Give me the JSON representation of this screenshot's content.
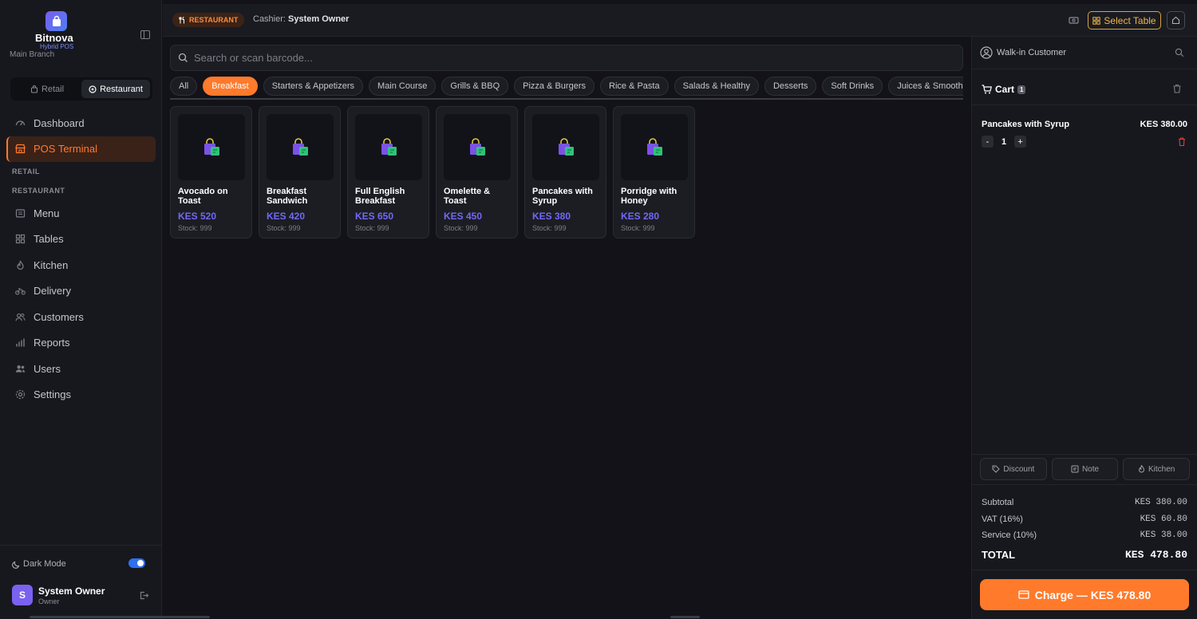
{
  "brand": {
    "name": "Bitnova",
    "subtitle": "Hybrid POS",
    "branch": "Main Branch"
  },
  "mode_switch": {
    "retail": "Retail",
    "restaurant": "Restaurant",
    "active": "restaurant"
  },
  "nav": {
    "dashboard": "Dashboard",
    "pos_terminal": "POS Terminal",
    "section_retail": "RETAIL",
    "section_restaurant": "RESTAURANT",
    "menu": "Menu",
    "tables": "Tables",
    "kitchen": "Kitchen",
    "delivery": "Delivery",
    "customers": "Customers",
    "reports": "Reports",
    "users": "Users",
    "settings": "Settings"
  },
  "footer": {
    "dark_mode": "Dark Mode",
    "dark_mode_on": true,
    "user_initial": "S",
    "user_name": "System Owner",
    "user_role": "Owner"
  },
  "topbar": {
    "mode_badge": "RESTAURANT",
    "cashier_label": "Cashier:",
    "cashier_name": "System Owner",
    "select_table": "Select Table"
  },
  "search": {
    "placeholder": "Search or scan barcode..."
  },
  "categories": [
    "All",
    "Breakfast",
    "Starters & Appetizers",
    "Main Course",
    "Grills & BBQ",
    "Pizza & Burgers",
    "Rice & Pasta",
    "Salads & Healthy",
    "Desserts",
    "Soft Drinks",
    "Juices & Smoothies"
  ],
  "active_category": "Breakfast",
  "products": [
    {
      "name": "Avocado on Toast",
      "price": "KES 520",
      "stock": "Stock: 999"
    },
    {
      "name": "Breakfast Sandwich",
      "price": "KES 420",
      "stock": "Stock: 999"
    },
    {
      "name": "Full English Breakfast",
      "price": "KES 650",
      "stock": "Stock: 999"
    },
    {
      "name": "Omelette & Toast",
      "price": "KES 450",
      "stock": "Stock: 999"
    },
    {
      "name": "Pancakes with Syrup",
      "price": "KES 380",
      "stock": "Stock: 999"
    },
    {
      "name": "Porridge with Honey",
      "price": "KES 280",
      "stock": "Stock: 999"
    }
  ],
  "cart": {
    "customer": "Walk-in Customer",
    "title": "Cart",
    "count": "1",
    "items": [
      {
        "name": "Pancakes with Syrup",
        "price": "KES 380.00",
        "qty": "1",
        "minus": "-",
        "plus": "+"
      }
    ],
    "actions": {
      "discount": "Discount",
      "note": "Note",
      "kitchen": "Kitchen"
    },
    "totals": {
      "subtotal_label": "Subtotal",
      "subtotal": "KES 380.00",
      "vat_label": "VAT (16%)",
      "vat": "KES 60.80",
      "service_label": "Service (10%)",
      "service": "KES 38.00",
      "total_label": "TOTAL",
      "total": "KES 478.80"
    },
    "charge_label": "Charge — KES 478.80"
  },
  "colors": {
    "accent": "#ff7a2b",
    "price": "#7169f5",
    "select_table": "#f0b64a",
    "danger": "#e53b3b"
  }
}
